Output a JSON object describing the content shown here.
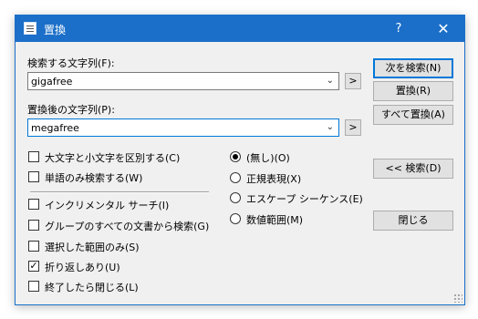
{
  "window": {
    "title": "置換",
    "help_glyph": "?",
    "close_glyph": "✕"
  },
  "find": {
    "label": "検索する文字列(F):",
    "value": "gigafree",
    "arrow": "⌄",
    "more": ">"
  },
  "replace": {
    "label": "置換後の文字列(P):",
    "value": "megafree",
    "arrow": "⌄",
    "more": ">"
  },
  "buttons": {
    "find_next": "次を検索(N)",
    "replace": "置換(R)",
    "replace_all": "すべて置換(A)",
    "search_back": "<< 検索(D)",
    "close": "閉じる"
  },
  "checks": [
    {
      "label": "大文字と小文字を区別する(C)",
      "checked": false
    },
    {
      "label": "単語のみ検索する(W)",
      "checked": false
    },
    {
      "label": "インクリメンタル サーチ(I)",
      "checked": false
    },
    {
      "label": "グループのすべての文書から検索(G)",
      "checked": false
    },
    {
      "label": "選択した範囲のみ(S)",
      "checked": false
    },
    {
      "label": "折り返しあり(U)",
      "checked": true
    },
    {
      "label": "終了したら閉じる(L)",
      "checked": false
    }
  ],
  "check_mark": "✓",
  "radios": [
    {
      "label": "(無し)(O)",
      "selected": true
    },
    {
      "label": "正規表現(X)",
      "selected": false
    },
    {
      "label": "エスケープ シーケンス(E)",
      "selected": false
    },
    {
      "label": "数値範囲(M)",
      "selected": false
    }
  ]
}
